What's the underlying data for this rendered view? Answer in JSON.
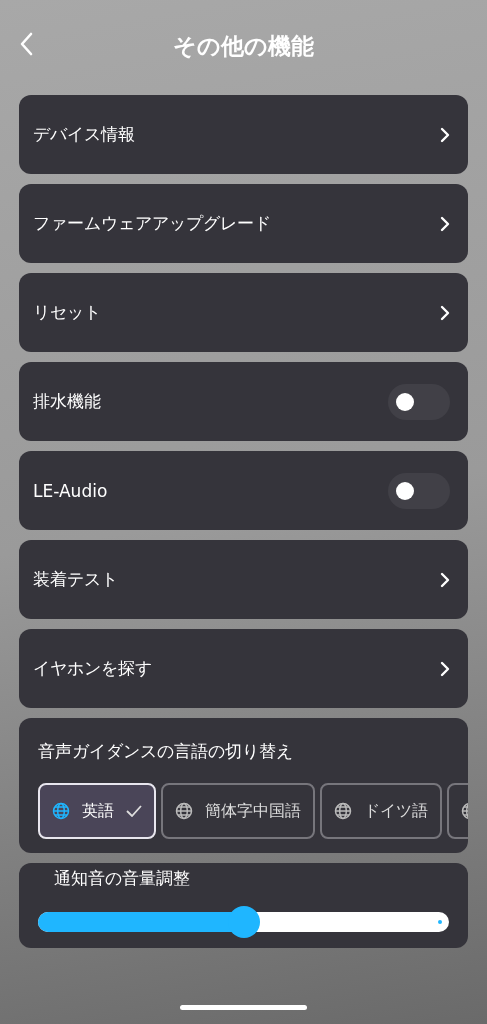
{
  "header": {
    "title": "その他の機能"
  },
  "items": [
    {
      "kind": "link",
      "label": "デバイス情報"
    },
    {
      "kind": "link",
      "label": "ファームウェアアップグレード"
    },
    {
      "kind": "link",
      "label": "リセット"
    },
    {
      "kind": "toggle",
      "label": "排水機能",
      "on": false
    },
    {
      "kind": "toggle",
      "label": "LE-Audio",
      "on": false
    },
    {
      "kind": "link",
      "label": "装着テスト"
    },
    {
      "kind": "link",
      "label": "イヤホンを探す"
    }
  ],
  "language": {
    "title": "音声ガイダンスの言語の切り替え",
    "options": [
      {
        "label": "英語",
        "selected": true
      },
      {
        "label": "簡体字中国語",
        "selected": false
      },
      {
        "label": "ドイツ語",
        "selected": false
      },
      {
        "selected": false
      }
    ]
  },
  "volume": {
    "title": "通知音の音量調整",
    "level": 0.5
  }
}
